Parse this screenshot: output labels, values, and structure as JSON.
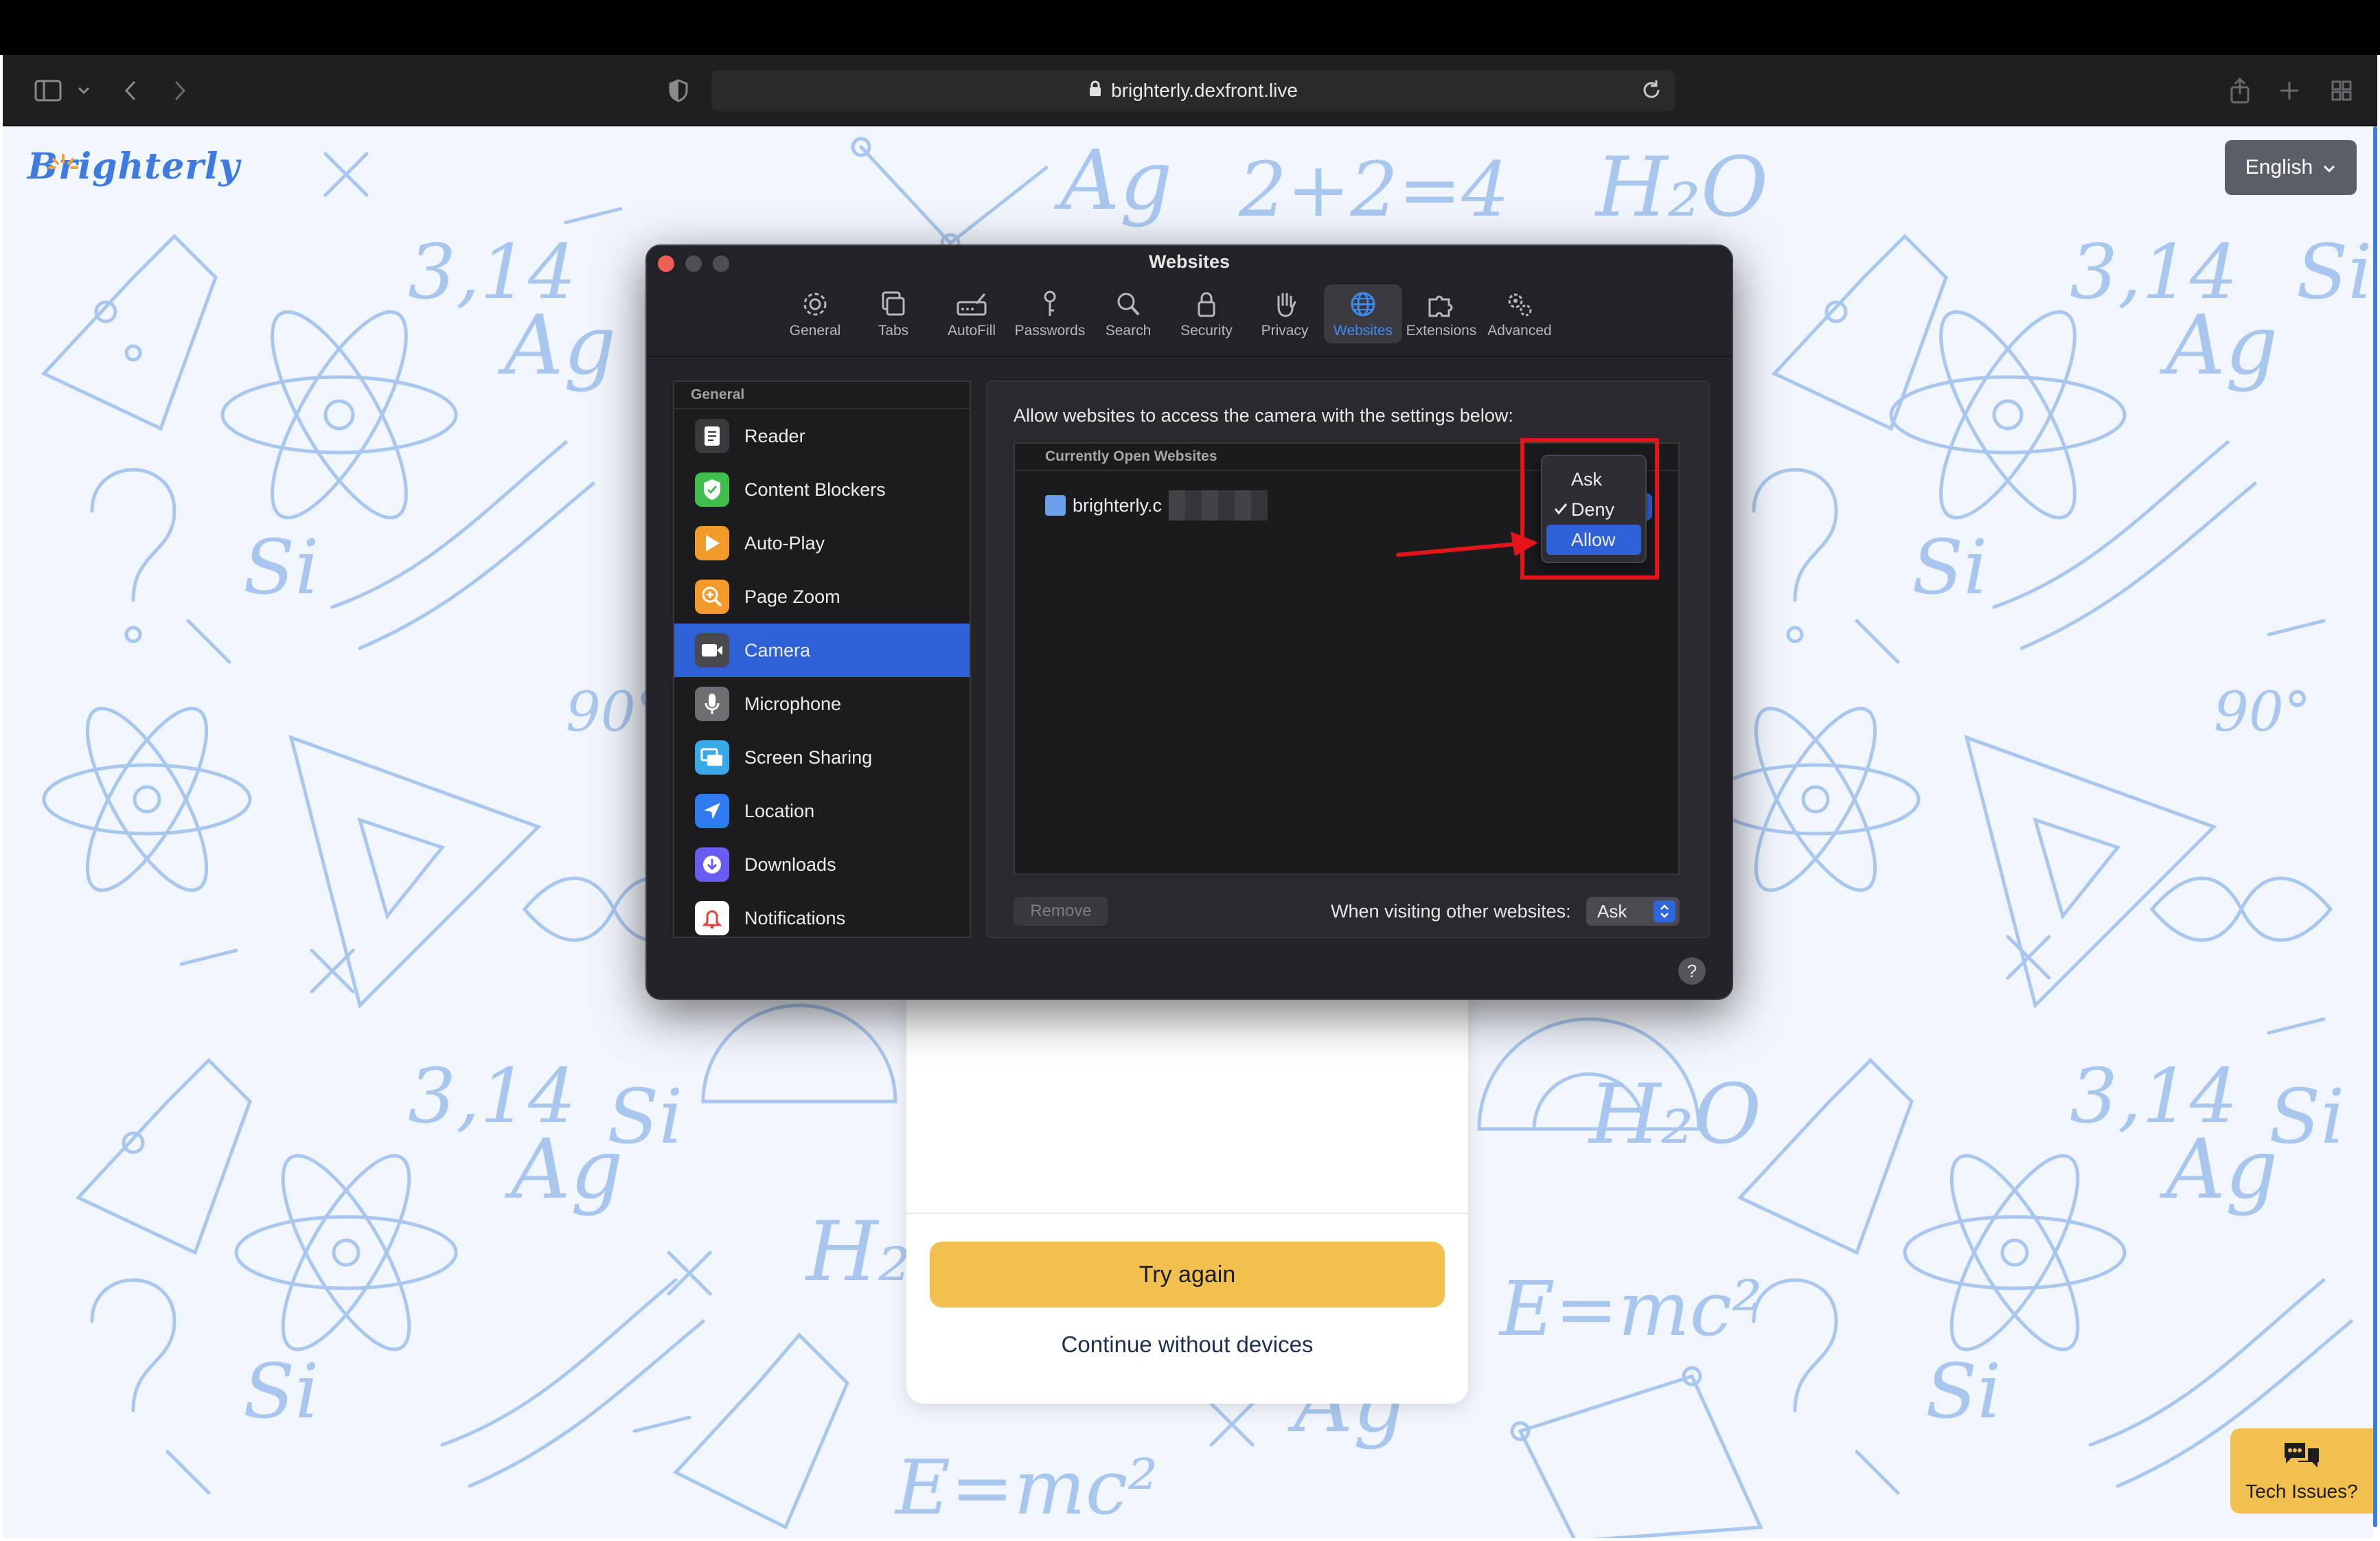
{
  "browser": {
    "url": "brighterly.dexfront.live"
  },
  "page": {
    "logo": "Brighterly",
    "language": "English",
    "try_again": "Try again",
    "continue": "Continue without devices",
    "tech_issues": "Tech Issues?"
  },
  "prefs": {
    "title": "Websites",
    "tabs": [
      {
        "label": "General",
        "icon": "gear-icon"
      },
      {
        "label": "Tabs",
        "icon": "tabs-icon"
      },
      {
        "label": "AutoFill",
        "icon": "autofill-icon"
      },
      {
        "label": "Passwords",
        "icon": "key-icon"
      },
      {
        "label": "Search",
        "icon": "magnifier-icon"
      },
      {
        "label": "Security",
        "icon": "lock-icon"
      },
      {
        "label": "Privacy",
        "icon": "hand-icon"
      },
      {
        "label": "Websites",
        "icon": "globe-icon"
      },
      {
        "label": "Extensions",
        "icon": "puzzle-icon"
      },
      {
        "label": "Advanced",
        "icon": "gears-icon"
      }
    ],
    "active_tab": "Websites",
    "sidebar": {
      "header": "General",
      "items": [
        {
          "label": "Reader",
          "icon": "reader-icon"
        },
        {
          "label": "Content Blockers",
          "icon": "shield-check-icon"
        },
        {
          "label": "Auto-Play",
          "icon": "play-icon"
        },
        {
          "label": "Page Zoom",
          "icon": "zoom-icon"
        },
        {
          "label": "Camera",
          "icon": "camera-icon"
        },
        {
          "label": "Microphone",
          "icon": "microphone-icon"
        },
        {
          "label": "Screen Sharing",
          "icon": "screen-sharing-icon"
        },
        {
          "label": "Location",
          "icon": "location-icon"
        },
        {
          "label": "Downloads",
          "icon": "download-icon"
        },
        {
          "label": "Notifications",
          "icon": "bell-icon"
        }
      ],
      "selected": "Camera"
    },
    "content": {
      "description": "Allow websites to access the camera with the settings below:",
      "list_header": "Currently Open Websites",
      "site": "brighterly.c",
      "menu": {
        "options": [
          "Ask",
          "Deny",
          "Allow"
        ],
        "checked": "Deny",
        "highlighted": "Allow"
      },
      "remove": "Remove",
      "other_label": "When visiting other websites:",
      "other_value": "Ask"
    },
    "help": "?"
  },
  "colors": {
    "accent_blue": "#2e60d6",
    "annotation_red": "#e3151a",
    "button_yellow": "#f2c04f",
    "doodle_blue": "#a9c7ee"
  }
}
